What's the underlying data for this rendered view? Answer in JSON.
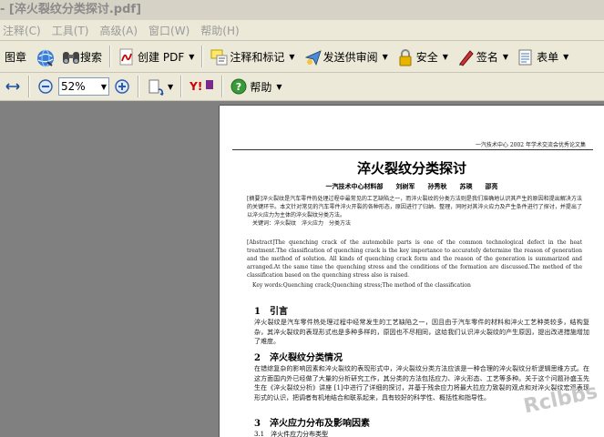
{
  "window": {
    "title": "- [淬火裂纹分类探讨.pdf]"
  },
  "menu": [
    "注释(C)",
    "工具(T)",
    "高级(A)",
    "窗口(W)",
    "帮助(H)"
  ],
  "toolbar1": {
    "image_label": "图章",
    "search_label": "搜索",
    "create_pdf_label": "创建 PDF",
    "comment_label": "注释和标记",
    "review_label": "发送供审阅",
    "security_label": "安全",
    "sign_label": "签名",
    "forms_label": "表单"
  },
  "toolbar2": {
    "zoom_value": "52%",
    "help_label": "帮助"
  },
  "paper": {
    "header": "一汽技术中心 2002 年学术交流会优秀论文集",
    "title": "淬火裂纹分类探讨",
    "authors": "一汽技术中心材料部　　刘树军　　孙秀秋　　苏瑛　　邵亮",
    "abstract_cn": "[摘要]淬火裂纹是汽车零件热处理过程中最常见的工艺缺陷之一，而淬火裂纹的分类方法则是我们准确地认识其产生的原因和提出解决方法的关键环节。本文针对常见的汽车零件淬火开裂的各种形态，原因进行了归纳、整理，同时对其淬火应力及产生条件进行了探讨，并提出了以淬火应力为主体的淬火裂纹分类方法。",
    "keywords_cn": "关键词：淬火裂纹　淬火应力　分类方法",
    "abstract_en": "[Abstract]The quenching crack of the automobile parts is one of the common technological defect in the heat treatment.The classification of quenching crack is the key importance to accurately determine the reason of generation and the method of solution. All kinds of quenching crack form and the reason of the generation is summarized and arranged.At the same time the quenching stress and the conditions of the formation are discussed.The method of the classification based on the quenching stress also is raised.",
    "keywords_en": "Key words:Quenching crack;Quenching stress;The method of the classification",
    "s1_title": "1　引言",
    "s1_body": "淬火裂纹是汽车零件热处理过程中经常发生的工艺缺陷之一，因且由于汽车零件的材料和淬火工艺种类较多，结构复杂，其淬火裂纹的表现形式也是多种多样的，原因也不尽相同，这给我们认识淬火裂纹的产生原因，提出改进措施增加了难度。",
    "s2_title": "2　淬火裂纹分类情况",
    "s2_body": "在错综复杂的影响因素和淬火裂纹的表现形式中，淬火裂纹分类方法应该是一种合理的淬火裂纹分析逻辑思维方式。在这方面国内外已经做了大量的分析研究工作，其分类的方法包括应力、淬火形态、工艺等多种。关于这个问题孙盛玉先生在《淬火裂纹分析》讲座 [1]中进行了详细的探讨，并基于残余应力将最大拉应力致裂的观点和对淬火裂纹宏观表现形式的认识，把调者有机地结合和联系起来，具有较好的科学性、概括性和指导性。",
    "s3_title": "3　淬火应力分布及影响因素",
    "s3_sub": "3.1　淬火件应力分布类型"
  },
  "watermark": "Rclbbs"
}
